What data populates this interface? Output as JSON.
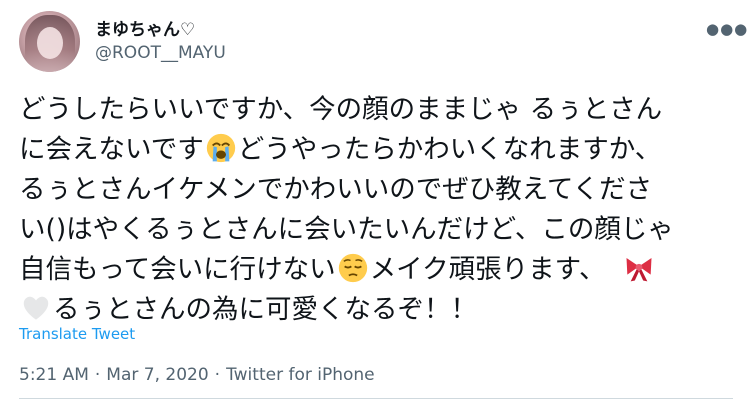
{
  "user": {
    "display_name": "まゆちゃん♡",
    "handle": "@ROOT__MAYU"
  },
  "more_icon": "more-dots-icon",
  "tweet": {
    "segments": {
      "l1": "どうしたらいいですか、今の顔のままじゃ るぅとさん",
      "l2a": "に会えないです",
      "l2b": "どうやったらかわいくなれますか、",
      "l3": "るぅとさんイケメンでかわいいのでぜひ教えてくださ",
      "l4": "い()はやくるぅとさんに会いたいんだけど、この顔じゃ",
      "l5a": "自信もって会いに行けない",
      "l5b": "メイク頑張ります、",
      "l6": "るぅとさんの為に可愛くなるぞ！！"
    },
    "emojis": [
      "loudly-crying-face-icon",
      "pensive-face-icon",
      "ribbon-icon",
      "white-heart-icon"
    ]
  },
  "translate_label": "Translate Tweet",
  "meta": {
    "time": "5:21 AM",
    "date": "Mar 7, 2020",
    "source": "Twitter for iPhone",
    "separator": "·"
  },
  "colors": {
    "text": "#0f1419",
    "secondary": "#536471",
    "link": "#1d9bf0",
    "divider": "#cfd9de"
  }
}
